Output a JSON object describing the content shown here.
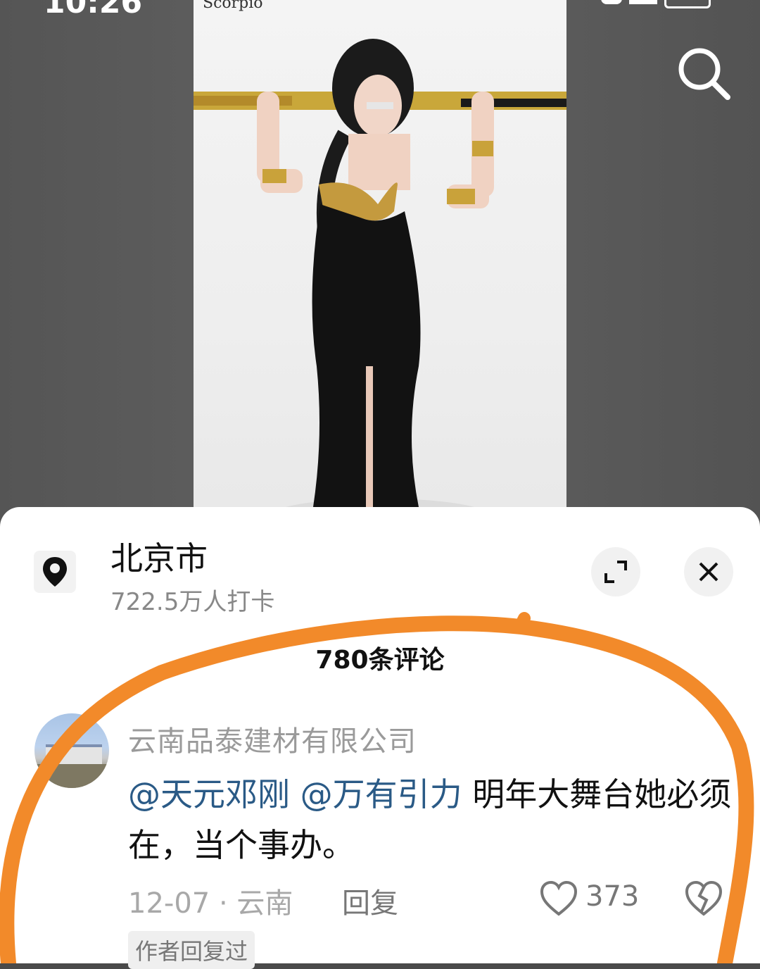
{
  "status_bar": {
    "time": "10:26"
  },
  "video": {
    "overlay_text": "Scorpio"
  },
  "location": {
    "title": "北京市",
    "checkins": "722.5万人打卡"
  },
  "comments": {
    "count_label": "780条评论",
    "items": [
      {
        "user": "云南品泰建材有限公司",
        "mention1": "@天元邓刚",
        "mention2": "@万有引力",
        "text": " 明年大舞台她必须在，当个事办。",
        "date": "12-07",
        "region": "云南",
        "reply_label": "回复",
        "likes": "373",
        "badge": "作者回复过"
      }
    ]
  },
  "colors": {
    "mention": "#2a5a86",
    "highlight_circle": "#f28a2a"
  },
  "icons": [
    "search-icon",
    "location-pin-icon",
    "expand-icon",
    "close-icon",
    "heart-icon",
    "broken-heart-icon"
  ]
}
